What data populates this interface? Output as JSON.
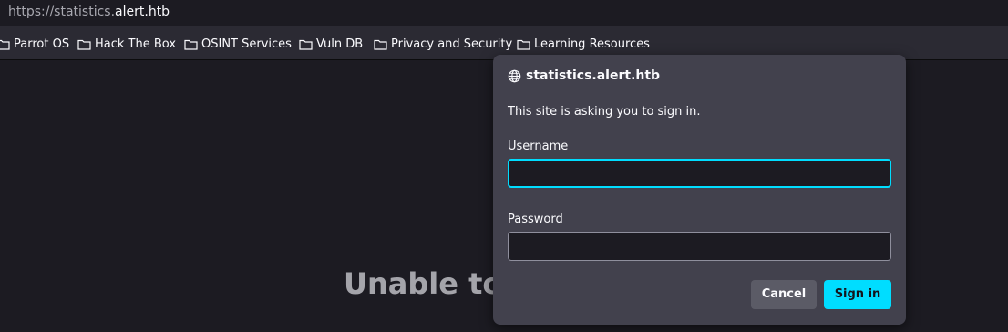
{
  "urlbar": {
    "url_prefix": "https://statistics.",
    "url_host": "alert.htb"
  },
  "bookmarks": [
    {
      "label": "Parrot OS",
      "icon": "folder-icon"
    },
    {
      "label": "Hack The Box",
      "icon": "folder-icon"
    },
    {
      "label": "OSINT Services",
      "icon": "folder-icon"
    },
    {
      "label": "Vuln DB",
      "icon": "folder-icon"
    },
    {
      "label": "Privacy and Security",
      "icon": "folder-icon"
    },
    {
      "label": "Learning Resources",
      "icon": "folder-icon"
    }
  ],
  "page": {
    "error_text": "Unable to"
  },
  "dialog": {
    "site": "statistics.alert.htb",
    "site_icon": "globe-icon",
    "message": "This site is asking you to sign in.",
    "username_label": "Username",
    "username_value": "",
    "password_label": "Password",
    "password_value": "",
    "cancel_label": "Cancel",
    "signin_label": "Sign in"
  },
  "colors": {
    "background": "#1c1b22",
    "toolbar": "#2b2a33",
    "dialog": "#42414d",
    "accent": "#00ddff",
    "cancel_button": "#5b5b66"
  }
}
